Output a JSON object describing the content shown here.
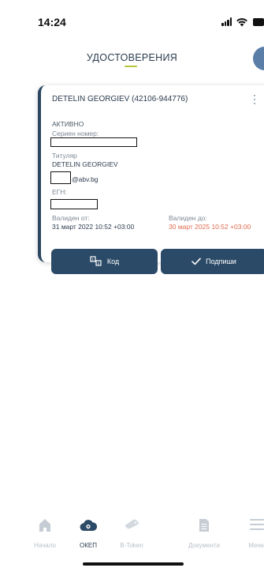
{
  "status_bar": {
    "time": "14:24"
  },
  "header": {
    "title": "УДОСТОВЕРЕНИЯ"
  },
  "certificate": {
    "name": "DETELIN GEORGIEV (42106-944776)",
    "status": "АКТИВНО",
    "serial_label": "Сериен номер:",
    "holder_label": "Титуляр",
    "holder_value": "DETELIN GEORGIEV",
    "email_suffix": "@abv.bg",
    "egn_label": "ЕГН:",
    "valid_from_label": "Валиден от:",
    "valid_from_value": "31 март 2022 10:52 +03:00",
    "valid_to_label": "Валиден до:",
    "valid_to_value": "30 март 2025 10:52 +03:00",
    "code_button": "Код",
    "sign_button": "Подпиши",
    "colors": {
      "accent": "#2b4a67",
      "expiry": "#e06b50"
    }
  },
  "tabbar": {
    "tabs": [
      {
        "label": "Начало",
        "icon": "home-icon",
        "active": false
      },
      {
        "label": "ОКЕП",
        "icon": "cloud-certificate-icon",
        "active": true
      },
      {
        "label": "B-Token",
        "icon": "token-icon",
        "active": false
      },
      {
        "label": "Документи",
        "icon": "document-icon",
        "active": false
      },
      {
        "label": "Меню",
        "icon": "menu-icon",
        "active": false
      }
    ]
  }
}
